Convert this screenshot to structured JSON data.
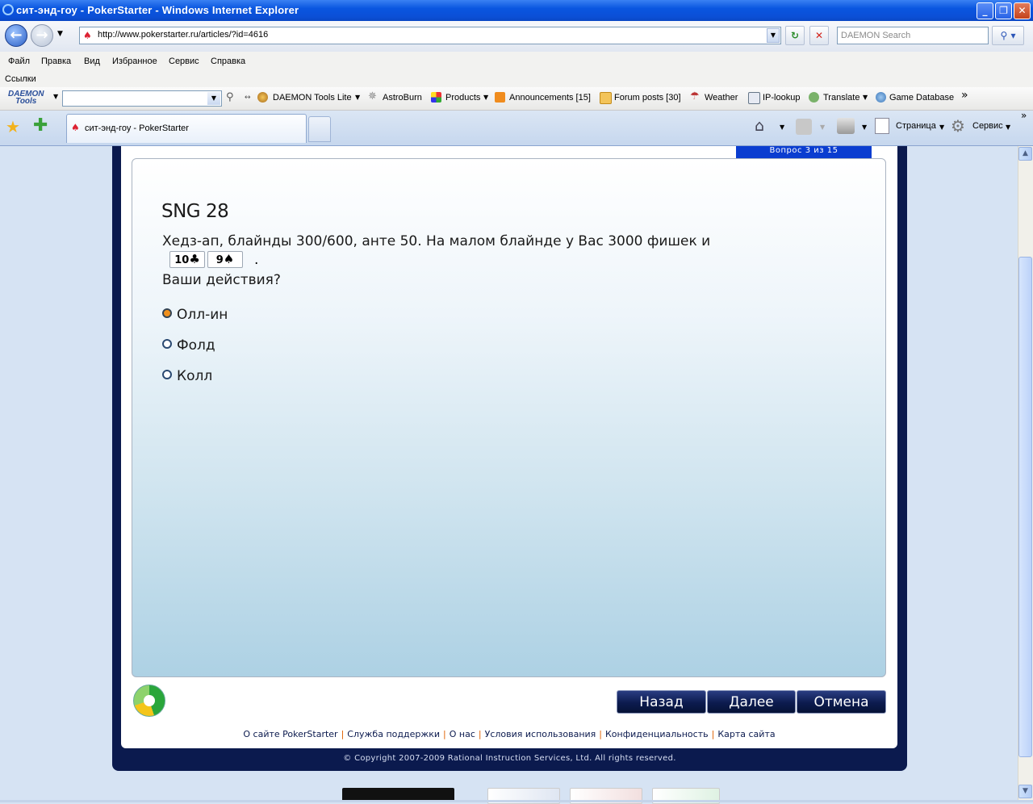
{
  "window": {
    "title": "сит-энд-гоу - PokerStarter - Windows Internet Explorer"
  },
  "address": {
    "url": "http://www.pokerstarter.ru/articles/?id=4616"
  },
  "search": {
    "placeholder": "DAEMON Search"
  },
  "menu": [
    "Файл",
    "Правка",
    "Вид",
    "Избранное",
    "Сервис",
    "Справка"
  ],
  "links_label": "Ссылки",
  "daemon_toolbar": {
    "logo_top": "DAEMON",
    "logo_bottom": "Tools",
    "items": [
      "DAEMON Tools Lite",
      "AstroBurn",
      "Products",
      "Announcements [15]",
      "Forum posts [30]",
      "Weather",
      "IP-lookup",
      "Translate",
      "Game Database"
    ]
  },
  "tab": {
    "label": "сит-энд-гоу - PokerStarter"
  },
  "commands": {
    "page": "Страница",
    "tools": "Сервис"
  },
  "quiz": {
    "progress": "Вопрос 3 из 15",
    "title": "SNG 28",
    "text": "Хедз-ап, блайнды 300/600, анте 50. На малом блайнде у Вас 3000 фишек и",
    "cards": [
      {
        "rank": "10",
        "suit": "♣"
      },
      {
        "rank": "9",
        "suit": "♠"
      }
    ],
    "punctuation": ".",
    "prompt": "Ваши действия?",
    "options": [
      {
        "label": "Олл-ин",
        "selected": true
      },
      {
        "label": "Фолд",
        "selected": false
      },
      {
        "label": "Колл",
        "selected": false
      }
    ],
    "buttons": {
      "back": "Назад",
      "next": "Далее",
      "cancel": "Отмена"
    }
  },
  "footer": {
    "links": [
      "О сайте PokerStarter",
      "Служба поддержки",
      "О нас",
      "Условия использования",
      "Конфиденциальность",
      "Карта сайта"
    ],
    "copyright": "© Copyright 2007-2009 Rational Instruction Services, Ltd. All rights reserved."
  },
  "colors": {
    "accent": "#0a3dd0",
    "frame": "#0b1a4e",
    "radio_selected": "#f0901c"
  }
}
